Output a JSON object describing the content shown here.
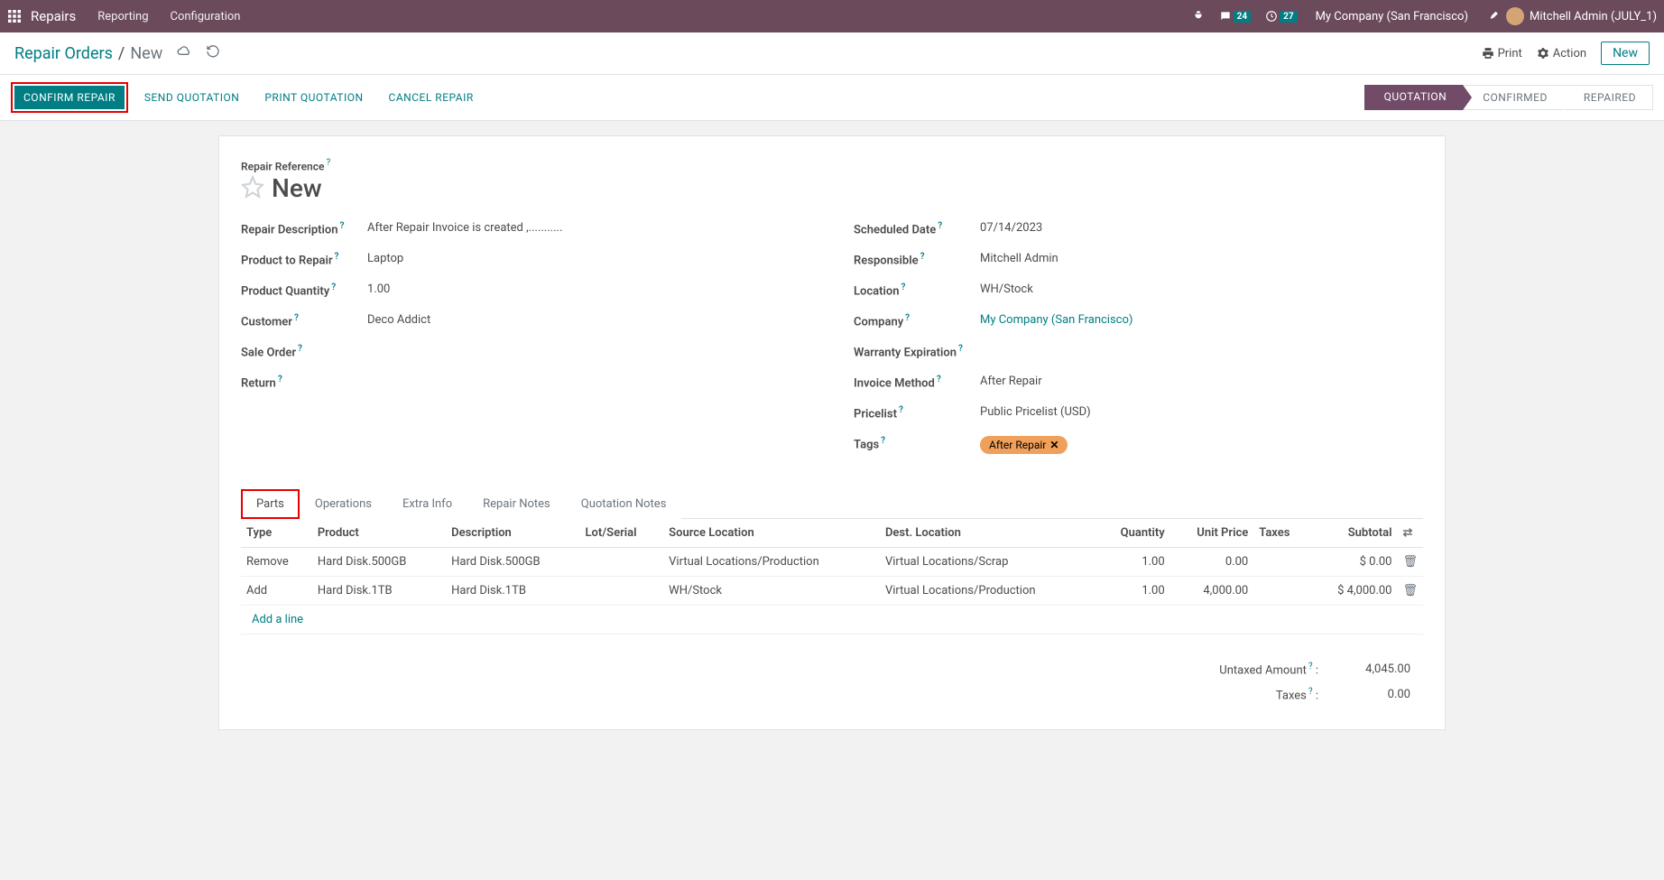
{
  "topbar": {
    "brand": "Repairs",
    "nav": [
      "Reporting",
      "Configuration"
    ],
    "messages_count": "24",
    "activities_count": "27",
    "company": "My Company (San Francisco)",
    "username": "Mitchell Admin (JULY_1)"
  },
  "breadcrumb": {
    "parent": "Repair Orders",
    "current": "New"
  },
  "cp_tools": {
    "print": "Print",
    "action": "Action",
    "new": "New"
  },
  "actions": {
    "confirm": "CONFIRM REPAIR",
    "send_quotation": "SEND QUOTATION",
    "print_quotation": "PRINT QUOTATION",
    "cancel_repair": "CANCEL REPAIR"
  },
  "statusbar": [
    "QUOTATION",
    "CONFIRMED",
    "REPAIRED"
  ],
  "form": {
    "reference_label": "Repair Reference",
    "reference_value": "New",
    "left": {
      "repair_description": {
        "label": "Repair Description",
        "value": "After Repair Invoice is created ,..........."
      },
      "product_to_repair": {
        "label": "Product to Repair",
        "value": "Laptop"
      },
      "product_quantity": {
        "label": "Product Quantity",
        "value": "1.00"
      },
      "customer": {
        "label": "Customer",
        "value": "Deco Addict"
      },
      "sale_order": {
        "label": "Sale Order",
        "value": ""
      },
      "return": {
        "label": "Return",
        "value": ""
      }
    },
    "right": {
      "scheduled_date": {
        "label": "Scheduled Date",
        "value": "07/14/2023"
      },
      "responsible": {
        "label": "Responsible",
        "value": "Mitchell Admin"
      },
      "location": {
        "label": "Location",
        "value": "WH/Stock"
      },
      "company": {
        "label": "Company",
        "value": "My Company (San Francisco)"
      },
      "warranty": {
        "label": "Warranty Expiration",
        "value": ""
      },
      "invoice_method": {
        "label": "Invoice Method",
        "value": "After Repair"
      },
      "pricelist": {
        "label": "Pricelist",
        "value": "Public Pricelist (USD)"
      },
      "tags": {
        "label": "Tags",
        "value": "After Repair"
      }
    }
  },
  "tabs": [
    "Parts",
    "Operations",
    "Extra Info",
    "Repair Notes",
    "Quotation Notes"
  ],
  "parts_table": {
    "headers": {
      "type": "Type",
      "product": "Product",
      "description": "Description",
      "lot": "Lot/Serial",
      "source": "Source Location",
      "dest": "Dest. Location",
      "qty": "Quantity",
      "unit_price": "Unit Price",
      "taxes": "Taxes",
      "subtotal": "Subtotal"
    },
    "rows": [
      {
        "type": "Remove",
        "product": "Hard Disk.500GB",
        "description": "Hard Disk.500GB",
        "lot": "",
        "source": "Virtual Locations/Production",
        "dest": "Virtual Locations/Scrap",
        "qty": "1.00",
        "unit_price": "0.00",
        "taxes": "",
        "subtotal": "$ 0.00"
      },
      {
        "type": "Add",
        "product": "Hard Disk.1TB",
        "description": "Hard Disk.1TB",
        "lot": "",
        "source": "WH/Stock",
        "dest": "Virtual Locations/Production",
        "qty": "1.00",
        "unit_price": "4,000.00",
        "taxes": "",
        "subtotal": "$ 4,000.00"
      }
    ],
    "add_line": "Add a line"
  },
  "totals": {
    "untaxed_label": "Untaxed Amount",
    "untaxed_value": "4,045.00",
    "taxes_label": "Taxes",
    "taxes_value": "0.00"
  }
}
